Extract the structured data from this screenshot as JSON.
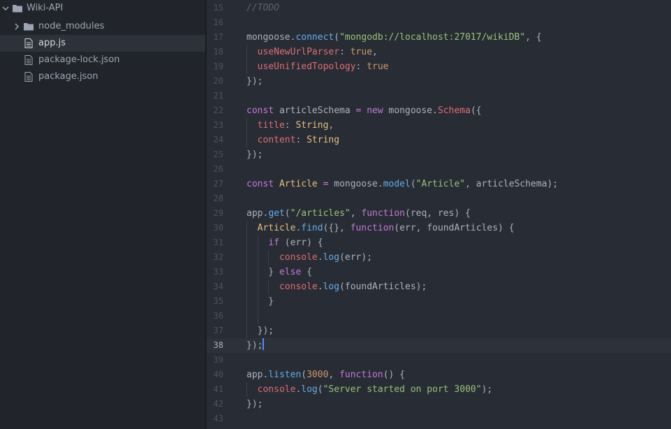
{
  "sidebar": {
    "root": {
      "label": "Wiki-API",
      "icon": "folder-open-icon"
    },
    "items": [
      {
        "label": "node_modules",
        "icon": "folder-icon",
        "type": "folder"
      },
      {
        "label": "app.js",
        "icon": "file-icon",
        "type": "file",
        "selected": true
      },
      {
        "label": "package-lock.json",
        "icon": "file-icon",
        "type": "file"
      },
      {
        "label": "package.json",
        "icon": "file-icon",
        "type": "file"
      }
    ]
  },
  "editor": {
    "active_line": 38,
    "lines": [
      {
        "n": "15",
        "tokens": [
          {
            "t": "//TODO",
            "c": "com"
          }
        ]
      },
      {
        "n": "16",
        "tokens": []
      },
      {
        "n": "17",
        "tokens": [
          {
            "t": "mongoose",
            "c": "var"
          },
          {
            "t": ".",
            "c": "var"
          },
          {
            "t": "connect",
            "c": "fn"
          },
          {
            "t": "(",
            "c": "var"
          },
          {
            "t": "\"mongodb://localhost:27017/wikiDB\"",
            "c": "str"
          },
          {
            "t": ", {",
            "c": "var"
          }
        ]
      },
      {
        "n": "18",
        "tokens": [
          {
            "t": "  ",
            "c": "var"
          },
          {
            "t": "useNewUrlParser",
            "c": "prop"
          },
          {
            "t": ": ",
            "c": "var"
          },
          {
            "t": "true",
            "c": "num"
          },
          {
            "t": ",",
            "c": "var"
          }
        ],
        "guides": [
          0
        ]
      },
      {
        "n": "19",
        "tokens": [
          {
            "t": "  ",
            "c": "var"
          },
          {
            "t": "useUnifiedTopology",
            "c": "prop"
          },
          {
            "t": ": ",
            "c": "var"
          },
          {
            "t": "true",
            "c": "num"
          }
        ],
        "guides": [
          0
        ]
      },
      {
        "n": "20",
        "tokens": [
          {
            "t": "});",
            "c": "var"
          }
        ]
      },
      {
        "n": "21",
        "tokens": []
      },
      {
        "n": "22",
        "tokens": [
          {
            "t": "const",
            "c": "kw"
          },
          {
            "t": " articleSchema ",
            "c": "var"
          },
          {
            "t": "=",
            "c": "kw"
          },
          {
            "t": " ",
            "c": "var"
          },
          {
            "t": "new",
            "c": "kw"
          },
          {
            "t": " mongoose.",
            "c": "var"
          },
          {
            "t": "Schema",
            "c": "prop"
          },
          {
            "t": "({",
            "c": "var"
          }
        ]
      },
      {
        "n": "23",
        "tokens": [
          {
            "t": "  ",
            "c": "var"
          },
          {
            "t": "title",
            "c": "prop"
          },
          {
            "t": ": ",
            "c": "var"
          },
          {
            "t": "String",
            "c": "cls"
          },
          {
            "t": ",",
            "c": "var"
          }
        ],
        "guides": [
          0
        ]
      },
      {
        "n": "24",
        "tokens": [
          {
            "t": "  ",
            "c": "var"
          },
          {
            "t": "content",
            "c": "prop"
          },
          {
            "t": ": ",
            "c": "var"
          },
          {
            "t": "String",
            "c": "cls"
          }
        ],
        "guides": [
          0
        ]
      },
      {
        "n": "25",
        "tokens": [
          {
            "t": "});",
            "c": "var"
          }
        ]
      },
      {
        "n": "26",
        "tokens": []
      },
      {
        "n": "27",
        "tokens": [
          {
            "t": "const",
            "c": "kw"
          },
          {
            "t": " ",
            "c": "var"
          },
          {
            "t": "Article",
            "c": "cls"
          },
          {
            "t": " ",
            "c": "var"
          },
          {
            "t": "=",
            "c": "kw"
          },
          {
            "t": " mongoose.",
            "c": "var"
          },
          {
            "t": "model",
            "c": "fn"
          },
          {
            "t": "(",
            "c": "var"
          },
          {
            "t": "\"Article\"",
            "c": "str"
          },
          {
            "t": ", articleSchema);",
            "c": "var"
          }
        ]
      },
      {
        "n": "28",
        "tokens": []
      },
      {
        "n": "29",
        "tokens": [
          {
            "t": "app.",
            "c": "var"
          },
          {
            "t": "get",
            "c": "fn"
          },
          {
            "t": "(",
            "c": "var"
          },
          {
            "t": "\"/articles\"",
            "c": "str"
          },
          {
            "t": ", ",
            "c": "var"
          },
          {
            "t": "function",
            "c": "kw"
          },
          {
            "t": "(req, res) {",
            "c": "var"
          }
        ]
      },
      {
        "n": "30",
        "tokens": [
          {
            "t": "  ",
            "c": "var"
          },
          {
            "t": "Article",
            "c": "cls"
          },
          {
            "t": ".",
            "c": "var"
          },
          {
            "t": "find",
            "c": "fn"
          },
          {
            "t": "({}, ",
            "c": "var"
          },
          {
            "t": "function",
            "c": "kw"
          },
          {
            "t": "(err, foundArticles) {",
            "c": "var"
          }
        ],
        "guides": [
          0
        ]
      },
      {
        "n": "31",
        "tokens": [
          {
            "t": "    ",
            "c": "var"
          },
          {
            "t": "if",
            "c": "kw"
          },
          {
            "t": " (err) {",
            "c": "var"
          }
        ],
        "guides": [
          0,
          1
        ]
      },
      {
        "n": "32",
        "tokens": [
          {
            "t": "      ",
            "c": "var"
          },
          {
            "t": "console",
            "c": "prop"
          },
          {
            "t": ".",
            "c": "var"
          },
          {
            "t": "log",
            "c": "fn"
          },
          {
            "t": "(err);",
            "c": "var"
          }
        ],
        "guides": [
          0,
          1,
          2
        ]
      },
      {
        "n": "33",
        "tokens": [
          {
            "t": "    } ",
            "c": "var"
          },
          {
            "t": "else",
            "c": "kw"
          },
          {
            "t": " {",
            "c": "var"
          }
        ],
        "guides": [
          0,
          1
        ]
      },
      {
        "n": "34",
        "tokens": [
          {
            "t": "      ",
            "c": "var"
          },
          {
            "t": "console",
            "c": "prop"
          },
          {
            "t": ".",
            "c": "var"
          },
          {
            "t": "log",
            "c": "fn"
          },
          {
            "t": "(foundArticles);",
            "c": "var"
          }
        ],
        "guides": [
          0,
          1,
          2
        ]
      },
      {
        "n": "35",
        "tokens": [
          {
            "t": "    }",
            "c": "var"
          }
        ],
        "guides": [
          0,
          1
        ]
      },
      {
        "n": "36",
        "tokens": [],
        "guides": [
          0,
          1
        ]
      },
      {
        "n": "37",
        "tokens": [
          {
            "t": "  });",
            "c": "var"
          }
        ],
        "guides": [
          0
        ]
      },
      {
        "n": "38",
        "tokens": [
          {
            "t": "});",
            "c": "var"
          }
        ],
        "cursor": true
      },
      {
        "n": "39",
        "tokens": []
      },
      {
        "n": "40",
        "tokens": [
          {
            "t": "app.",
            "c": "var"
          },
          {
            "t": "listen",
            "c": "fn"
          },
          {
            "t": "(",
            "c": "var"
          },
          {
            "t": "3000",
            "c": "num"
          },
          {
            "t": ", ",
            "c": "var"
          },
          {
            "t": "function",
            "c": "kw"
          },
          {
            "t": "() {",
            "c": "var"
          }
        ]
      },
      {
        "n": "41",
        "tokens": [
          {
            "t": "  ",
            "c": "var"
          },
          {
            "t": "console",
            "c": "prop"
          },
          {
            "t": ".",
            "c": "var"
          },
          {
            "t": "log",
            "c": "fn"
          },
          {
            "t": "(",
            "c": "var"
          },
          {
            "t": "\"Server started on port 3000\"",
            "c": "str"
          },
          {
            "t": ");",
            "c": "var"
          }
        ],
        "guides": [
          0
        ]
      },
      {
        "n": "42",
        "tokens": [
          {
            "t": "});",
            "c": "var"
          }
        ]
      },
      {
        "n": "43",
        "tokens": []
      }
    ]
  },
  "colors": {
    "sidebar_bg": "#21252b",
    "editor_bg": "#282c34",
    "selection": "#2c313a",
    "cursor": "#528bff"
  }
}
